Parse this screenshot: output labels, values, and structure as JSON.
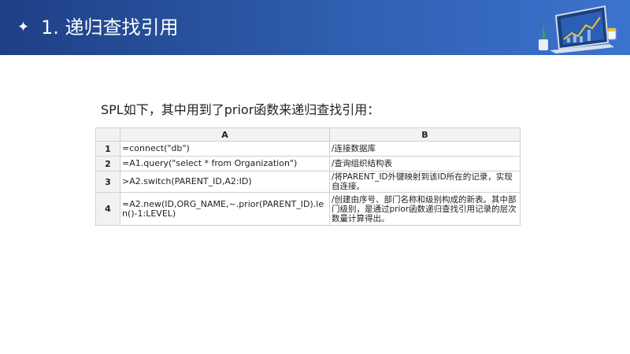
{
  "header": {
    "star_glyph": "✦",
    "title": "1. 递归查找引用"
  },
  "intro": {
    "text": "SPL如下，其中用到了prior函数来递归查找引用："
  },
  "table": {
    "columns": [
      "A",
      "B"
    ],
    "rows": [
      {
        "index": "1",
        "a": "=connect(\"db\")",
        "b": "/连接数据库"
      },
      {
        "index": "2",
        "a": "=A1.query(\"select * from Organization\")",
        "b": "/查询组织结构表"
      },
      {
        "index": "3",
        "a": ">A2.switch(PARENT_ID,A2:ID)",
        "b": "/将PARENT_ID外键映射到该ID所在的记录，实现自连接。"
      },
      {
        "index": "4",
        "a": "=A2.new(ID,ORG_NAME,~.prior(PARENT_ID).len()-1:LEVEL)",
        "b": "/创建由序号、部门名称和级别构成的新表。其中部门级别，是通过prior函数递归查找引用记录的层次数量计算得出。"
      }
    ]
  },
  "colors": {
    "header_dark": "#1f3f86",
    "header_light": "#3c73cf",
    "table_border": "#d0d0d0",
    "table_header_bg": "#f2f2f2"
  },
  "icons": {
    "header_star": "sparkle-star-icon",
    "header_illustration": "laptop-chart-illustration"
  }
}
